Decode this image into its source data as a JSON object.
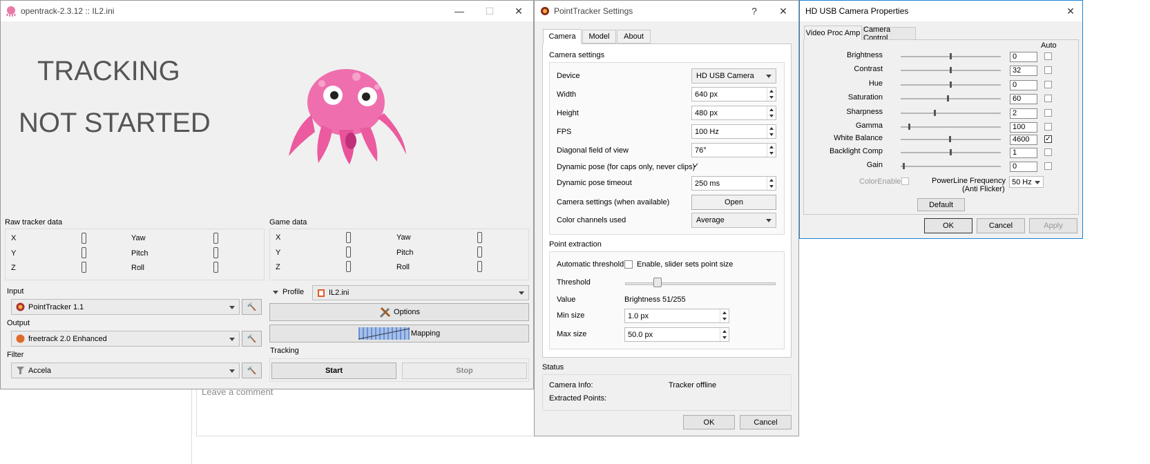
{
  "background": {
    "comment_placeholder": "Leave a comment"
  },
  "main": {
    "title": "opentrack-2.3.12 :: IL2.ini",
    "status_line1": "TRACKING",
    "status_line2": "NOT STARTED",
    "raw_tracker": {
      "title": "Raw tracker data",
      "x": "X",
      "y": "Y",
      "z": "Z",
      "yaw": "Yaw",
      "pitch": "Pitch",
      "roll": "Roll"
    },
    "game_data": {
      "title": "Game data",
      "x": "X",
      "y": "Y",
      "z": "Z",
      "yaw": "Yaw",
      "pitch": "Pitch",
      "roll": "Roll"
    },
    "input": {
      "label": "Input",
      "value": "PointTracker 1.1"
    },
    "output": {
      "label": "Output",
      "value": "freetrack 2.0 Enhanced"
    },
    "filter": {
      "label": "Filter",
      "value": "Accela"
    },
    "profile": {
      "label": "Profile",
      "value": "IL2.ini"
    },
    "options_label": "Options",
    "mapping_label": "Mapping",
    "tracking": {
      "label": "Tracking",
      "start": "Start",
      "stop": "Stop"
    }
  },
  "pt": {
    "title": "PointTracker Settings",
    "help": "?",
    "tabs": [
      "Camera",
      "Model",
      "About"
    ],
    "camera_settings": {
      "title": "Camera settings",
      "device_label": "Device",
      "device": "HD USB Camera",
      "width_label": "Width",
      "width": "640 px",
      "height_label": "Height",
      "height": "480 px",
      "fps_label": "FPS",
      "fps": "100 Hz",
      "fov_label": "Diagonal field of view",
      "fov": "76°",
      "dyn_pose_label": "Dynamic pose (for caps only, never clips)",
      "dyn_timeout_label": "Dynamic pose timeout",
      "dyn_timeout": "250 ms",
      "cam_settings_label": "Camera settings (when available)",
      "open": "Open",
      "color_label": "Color channels used",
      "color": "Average"
    },
    "point_extraction": {
      "title": "Point extraction",
      "auto_label": "Automatic threshold",
      "auto_check": "Enable, slider sets point size",
      "threshold_label": "Threshold",
      "threshold_fraction": 0.2,
      "value_label": "Value",
      "value": "Brightness 51/255",
      "min_label": "Min size",
      "min": "1.0 px",
      "max_label": "Max size",
      "max": "50.0 px"
    },
    "status": {
      "title": "Status",
      "cam_info_label": "Camera Info:",
      "cam_info": "Tracker offline",
      "points_label": "Extracted Points:"
    },
    "ok": "OK",
    "cancel": "Cancel"
  },
  "cam": {
    "title": "HD USB Camera Properties",
    "tabs": [
      "Video Proc Amp",
      "Camera Control"
    ],
    "auto_header": "Auto",
    "controls": [
      {
        "label": "Brightness",
        "value": "0",
        "level": 0.5,
        "auto": false
      },
      {
        "label": "Contrast",
        "value": "32",
        "level": 0.5,
        "auto": false
      },
      {
        "label": "Hue",
        "value": "0",
        "level": 0.5,
        "auto": false
      },
      {
        "label": "Saturation",
        "value": "60",
        "level": 0.47,
        "auto": false
      },
      {
        "label": "Sharpness",
        "value": "2",
        "level": 0.34,
        "auto": false
      },
      {
        "label": "Gamma",
        "value": "100",
        "level": 0.08,
        "auto": false
      },
      {
        "label": "White Balance",
        "value": "4600",
        "level": 0.49,
        "auto": true
      },
      {
        "label": "Backlight Comp",
        "value": "1",
        "level": 0.5,
        "auto": false
      },
      {
        "label": "Gain",
        "value": "0",
        "level": 0.02,
        "auto": false
      }
    ],
    "color_enable": "ColorEnable",
    "powerline_label1": "PowerLine Frequency",
    "powerline_label2": "(Anti Flicker)",
    "powerline": "50 Hz",
    "default": "Default",
    "ok": "OK",
    "cancel": "Cancel",
    "apply": "Apply"
  }
}
